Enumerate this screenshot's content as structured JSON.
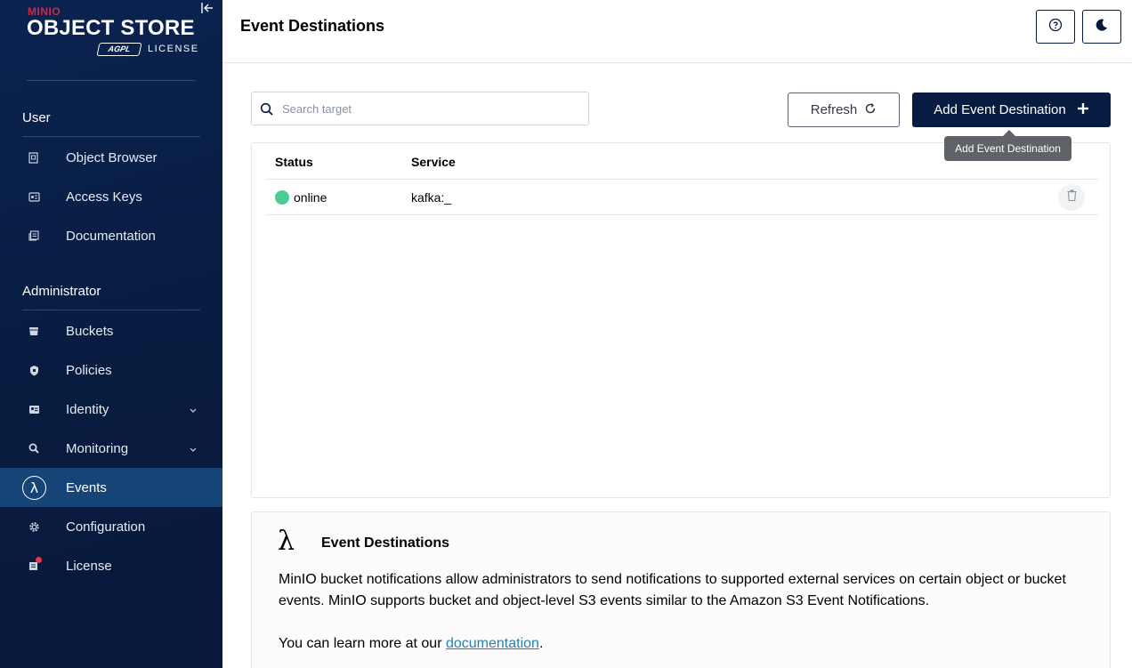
{
  "logo": {
    "brand": "MINIO",
    "product": "OBJECT STORE",
    "agpl": "AGPL",
    "license": "LICENSE"
  },
  "sidebar": {
    "sections": [
      {
        "title": "User",
        "items": [
          {
            "label": "Object Browser",
            "icon": "object-browser-icon"
          },
          {
            "label": "Access Keys",
            "icon": "access-keys-icon"
          },
          {
            "label": "Documentation",
            "icon": "documentation-icon"
          }
        ]
      },
      {
        "title": "Administrator",
        "items": [
          {
            "label": "Buckets",
            "icon": "buckets-icon"
          },
          {
            "label": "Policies",
            "icon": "policies-icon"
          },
          {
            "label": "Identity",
            "icon": "identity-icon",
            "expandable": true
          },
          {
            "label": "Monitoring",
            "icon": "monitoring-icon",
            "expandable": true
          },
          {
            "label": "Events",
            "icon": "lambda-icon",
            "active": true
          },
          {
            "label": "Configuration",
            "icon": "gear-icon"
          },
          {
            "label": "License",
            "icon": "license-icon",
            "badge": "red-dot"
          }
        ]
      }
    ]
  },
  "header": {
    "title": "Event Destinations",
    "help_icon": "help-icon",
    "theme_icon": "moon-icon"
  },
  "toolbar": {
    "search_placeholder": "Search target",
    "refresh_label": "Refresh",
    "add_label": "Add Event Destination",
    "tooltip": "Add Event Destination"
  },
  "table": {
    "columns": [
      "Status",
      "Service"
    ],
    "rows": [
      {
        "status": "online",
        "service": "kafka:_"
      }
    ]
  },
  "help": {
    "title": "Event Destinations",
    "paragraph": "MinIO bucket notifications allow administrators to send notifications to supported external services on certain object or bucket events. MinIO supports bucket and object-level S3 events similar to the Amazon S3 Event Notifications.",
    "learn_prefix": "You can learn more at our ",
    "link_text": "documentation",
    "learn_suffix": "."
  },
  "colors": {
    "sidebar_bg": "#0a2350",
    "sidebar_active": "#174476",
    "primary_button": "#081c42",
    "status_online": "#4ccb92",
    "link": "#2781b0"
  }
}
